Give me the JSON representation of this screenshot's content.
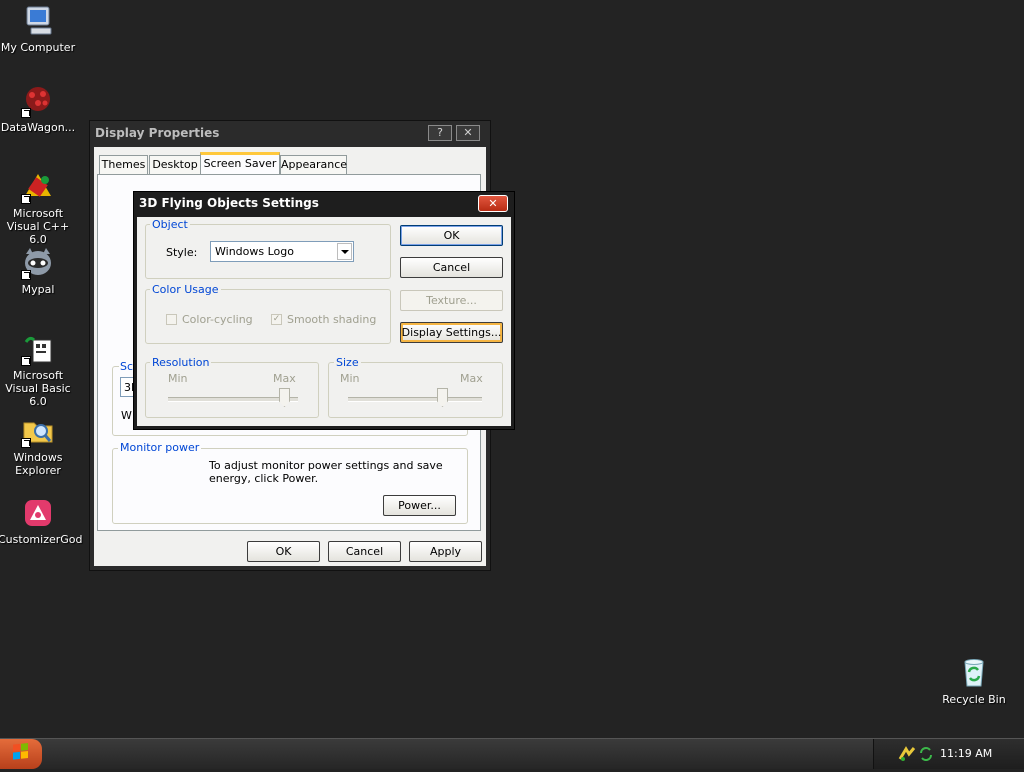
{
  "desktop": {
    "icons": [
      {
        "label": "My Computer",
        "icon": "computer-icon"
      },
      {
        "label": "DataWagon...",
        "icon": "datawagon-icon"
      },
      {
        "label": "Microsoft Visual C++ 6.0",
        "icon": "visual-cpp-icon"
      },
      {
        "label": "Mypal",
        "icon": "mypal-icon"
      },
      {
        "label": "Microsoft Visual Basic 6.0",
        "icon": "visual-basic-icon"
      },
      {
        "label": "Windows Explorer",
        "icon": "explorer-icon"
      },
      {
        "label": "CustomizerGod",
        "icon": "customizergod-icon"
      },
      {
        "label": "Recycle Bin",
        "icon": "recycle-bin-icon"
      }
    ]
  },
  "display_properties": {
    "title": "Display Properties",
    "help_glyph": "?",
    "close_glyph": "✕",
    "tabs": [
      "Themes",
      "Desktop",
      "Screen Saver",
      "Appearance"
    ],
    "active_tab": "Screen Saver",
    "screensaver_label_partial": "Sc",
    "screensaver_value_partial": "3D",
    "wait_label_partial": "W",
    "monitor_power": {
      "label": "Monitor power",
      "text": "To adjust monitor power settings and save energy, click Power.",
      "button": "Power..."
    },
    "buttons": {
      "ok": "OK",
      "cancel": "Cancel",
      "apply": "Apply"
    }
  },
  "settings_dialog": {
    "title": "3D Flying Objects Settings",
    "close_glyph": "✕",
    "object": {
      "label": "Object",
      "style_label": "Style:",
      "style_value": "Windows Logo"
    },
    "color_usage": {
      "label": "Color Usage",
      "color_cycling": {
        "label": "Color-cycling",
        "checked": false
      },
      "smooth_shading": {
        "label": "Smooth shading",
        "checked": true,
        "check_glyph": "✓"
      }
    },
    "resolution": {
      "label": "Resolution",
      "min": "Min",
      "max": "Max",
      "level": 0.93
    },
    "size": {
      "label": "Size",
      "min": "Min",
      "max": "Max",
      "level": 0.72
    },
    "buttons": {
      "ok": "OK",
      "cancel": "Cancel",
      "texture": "Texture...",
      "display_settings": "Display Settings..."
    }
  },
  "taskbar": {
    "clock": "11:19 AM"
  },
  "colors": {
    "desktop_bg": "#232323",
    "group_label": "#0046d5",
    "close_red": "#c8371f",
    "focus_orange": "#f5b543"
  }
}
